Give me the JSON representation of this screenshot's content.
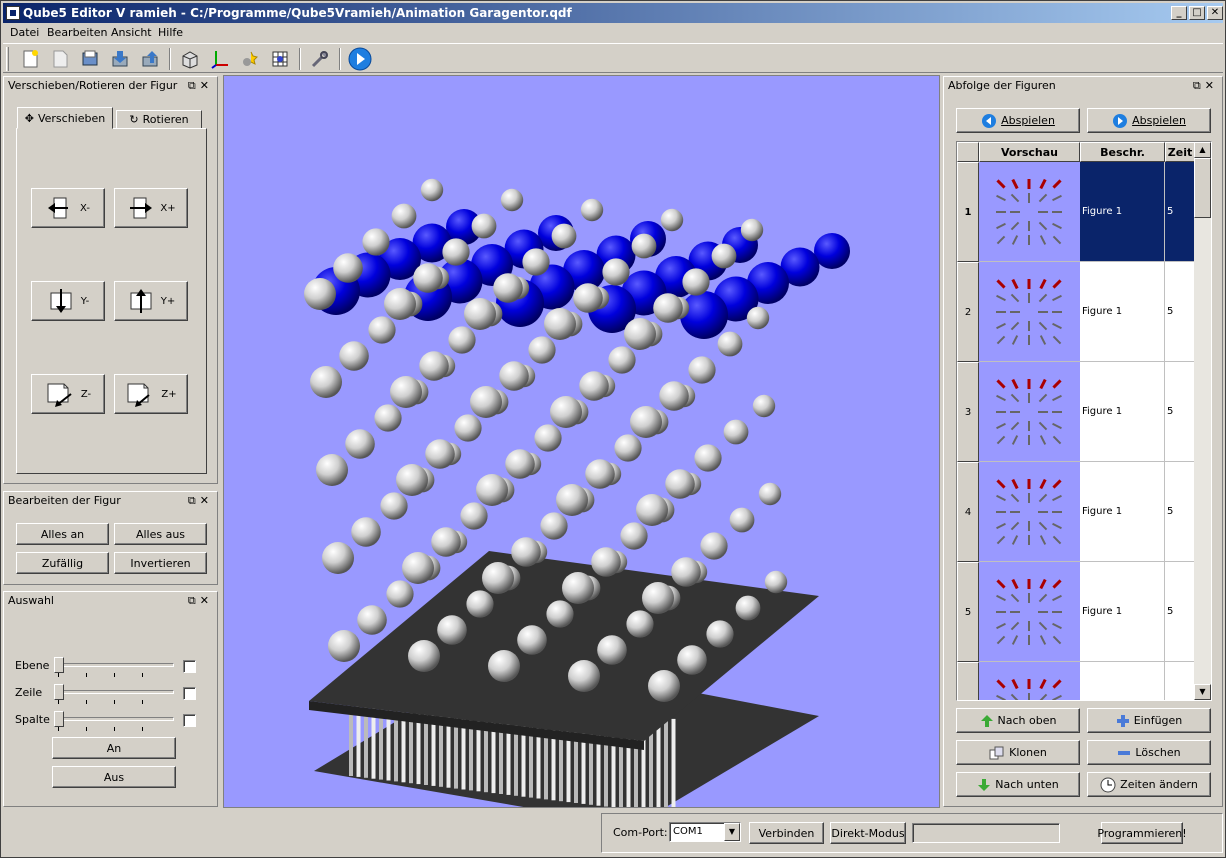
{
  "window": {
    "title": "Qube5 Editor V ramieh - C:/Programme/Qube5Vramieh/Animation Garagentor.qdf",
    "min_label": "_",
    "max_label": "□",
    "close_label": "✕"
  },
  "menu": {
    "items": [
      "Datei",
      "Bearbeiten",
      "Ansicht",
      "Hilfe"
    ]
  },
  "toolbar": {
    "icons": [
      "new-file-icon",
      "blank-file-icon",
      "open-icon",
      "save-icon",
      "save-as-icon",
      "cube-icon",
      "axes-icon",
      "effects-icon",
      "grid-icon",
      "tools-icon",
      "play-icon"
    ]
  },
  "move_panel": {
    "title": "Verschieben/Rotieren der Figur",
    "float_icon": "⧉",
    "close_icon": "✕",
    "tab_move": "Verschieben",
    "tab_rotate": "Rotieren",
    "buttons": {
      "x_minus": "X-",
      "x_plus": "X+",
      "y_minus": "Y-",
      "y_plus": "Y+",
      "z_minus": "Z-",
      "z_plus": "Z+"
    }
  },
  "edit_panel": {
    "title": "Bearbeiten der Figur",
    "all_on": "Alles an",
    "all_off": "Alles aus",
    "random": "Zufällig",
    "invert": "Invertieren"
  },
  "select_panel": {
    "title": "Auswahl",
    "layer": "Ebene",
    "row": "Zeile",
    "column": "Spalte",
    "on": "An",
    "off": "Aus"
  },
  "sequence_panel": {
    "title": "Abfolge der Figuren",
    "play_back": "Abspielen",
    "play_forward": "Abspielen",
    "columns": [
      "Vorschau",
      "Beschr.",
      "Zeit"
    ],
    "rows": [
      {
        "num": "1",
        "desc": "Figure 1",
        "time": "5",
        "selected": true
      },
      {
        "num": "2",
        "desc": "Figure 1",
        "time": "5",
        "selected": false
      },
      {
        "num": "3",
        "desc": "Figure 1",
        "time": "5",
        "selected": false
      },
      {
        "num": "4",
        "desc": "Figure 1",
        "time": "5",
        "selected": false
      },
      {
        "num": "5",
        "desc": "Figure 1",
        "time": "5",
        "selected": false
      },
      {
        "num": "",
        "desc": "",
        "time": "",
        "selected": false
      }
    ],
    "move_up": "Nach oben",
    "insert": "Einfügen",
    "clone": "Klonen",
    "delete": "Löschen",
    "move_down": "Nach unten",
    "change_times": "Zeiten ändern"
  },
  "status": {
    "com_port_label": "Com-Port:",
    "com_port_value": "COM1",
    "connect": "Verbinden",
    "direct_mode": "Direkt-Modus",
    "program": "Programmieren!"
  },
  "colors": {
    "title_start": "#0a246a",
    "title_end": "#a6caf0",
    "viewport_bg": "#9999ff",
    "led_on": "#0000cc",
    "led_off": "#c8c8c8",
    "selection": "#0a246a"
  }
}
